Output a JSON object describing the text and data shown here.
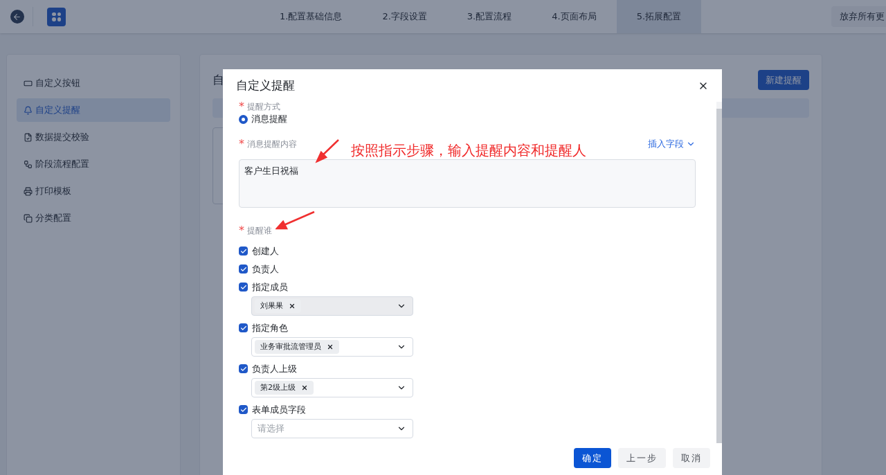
{
  "topbar": {
    "steps": [
      {
        "label": "1.配置基础信息",
        "selected": false
      },
      {
        "label": "2.字段设置",
        "selected": false
      },
      {
        "label": "3.配置流程",
        "selected": false
      },
      {
        "label": "4.页面布局",
        "selected": false
      },
      {
        "label": "5.拓展配置",
        "selected": true
      }
    ],
    "discard_button": "放弃所有更"
  },
  "sidebar": {
    "items": [
      {
        "label": "自定义按钮",
        "selected": false
      },
      {
        "label": "自定义提醒",
        "selected": true
      },
      {
        "label": "数据提交校验",
        "selected": false
      },
      {
        "label": "阶段流程配置",
        "selected": false
      },
      {
        "label": "打印模板",
        "selected": false
      },
      {
        "label": "分类配置",
        "selected": false
      }
    ]
  },
  "main": {
    "title": "自",
    "new_button": "新建提醒"
  },
  "dialog": {
    "title": "自定义提醒",
    "method": {
      "label": "提醒方式",
      "required_mark": "*",
      "options": [
        {
          "label": "消息提醒",
          "selected": true
        }
      ]
    },
    "content": {
      "label": "消息提醒内容",
      "required_mark": "*",
      "insert_link": "插入字段",
      "value": "客户生日祝福"
    },
    "recipients": {
      "label": "提醒谁",
      "required_mark": "*",
      "options": [
        {
          "label": "创建人",
          "checked": true
        },
        {
          "label": "负责人",
          "checked": true
        },
        {
          "label": "指定成员",
          "checked": true,
          "select": {
            "tags": [
              "刘果果"
            ],
            "hovered": true
          }
        },
        {
          "label": "指定角色",
          "checked": true,
          "select": {
            "tags": [
              "业务审批流管理员"
            ],
            "hovered": false
          }
        },
        {
          "label": "负责人上级",
          "checked": true,
          "select": {
            "tags": [
              "第2级上级"
            ],
            "hovered": false
          }
        },
        {
          "label": "表单成员字段",
          "checked": true,
          "select": {
            "placeholder": "请选择",
            "hovered": false
          }
        }
      ]
    },
    "buttons": [
      {
        "label": "确定",
        "kind": "primary"
      },
      {
        "label": "上一步",
        "kind": "secondary"
      },
      {
        "label": "取消",
        "kind": "secondary"
      }
    ]
  },
  "annotation": {
    "text": "按照指示步骤，输入提醒内容和提醒人"
  }
}
